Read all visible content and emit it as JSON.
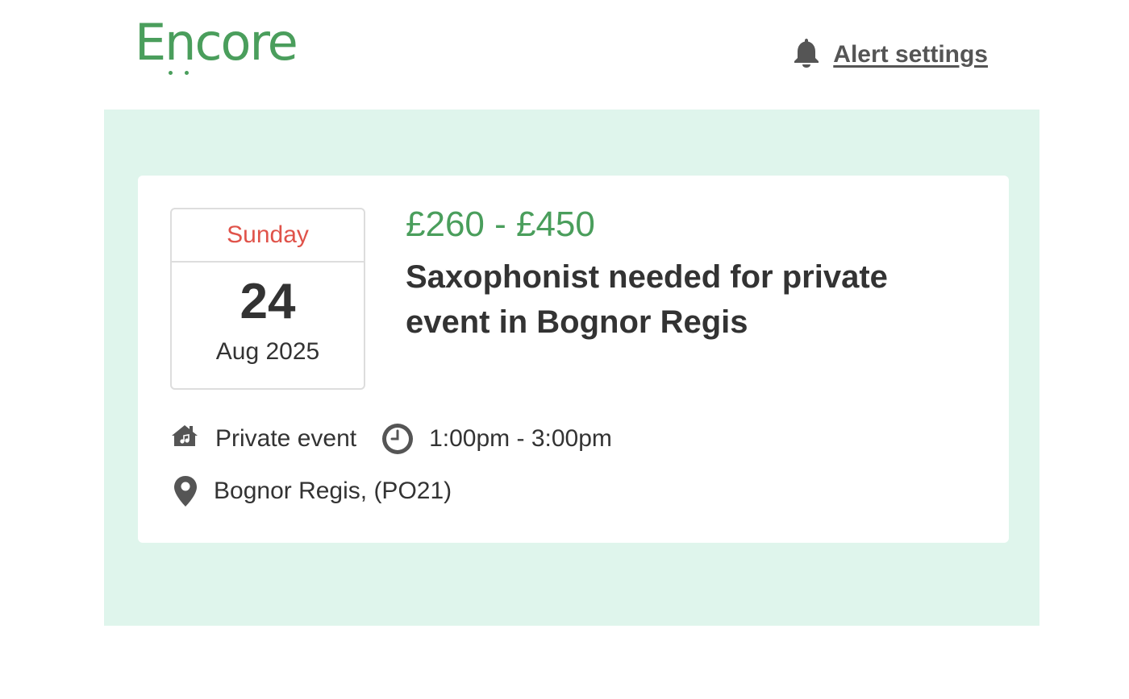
{
  "colors": {
    "brand_green": "#4a9e5c",
    "panel_bg": "#dff5ec",
    "day_red": "#e0534a",
    "icon_grey": "#555555"
  },
  "header": {
    "logo_text": "Encore",
    "alert_icon": "bell-icon",
    "alert_label": "Alert settings"
  },
  "listing": {
    "day_name": "Sunday",
    "day_number": "24",
    "month_year": "Aug 2025",
    "price": "£260 - £450",
    "title": "Saxophonist needed for private event in Bognor Regis",
    "event_type_icon": "house-music-icon",
    "event_type": "Private event",
    "time_icon": "clock-icon",
    "time": "1:00pm - 3:00pm",
    "location_icon": "map-pin-icon",
    "location": "Bognor Regis, (PO21)"
  }
}
